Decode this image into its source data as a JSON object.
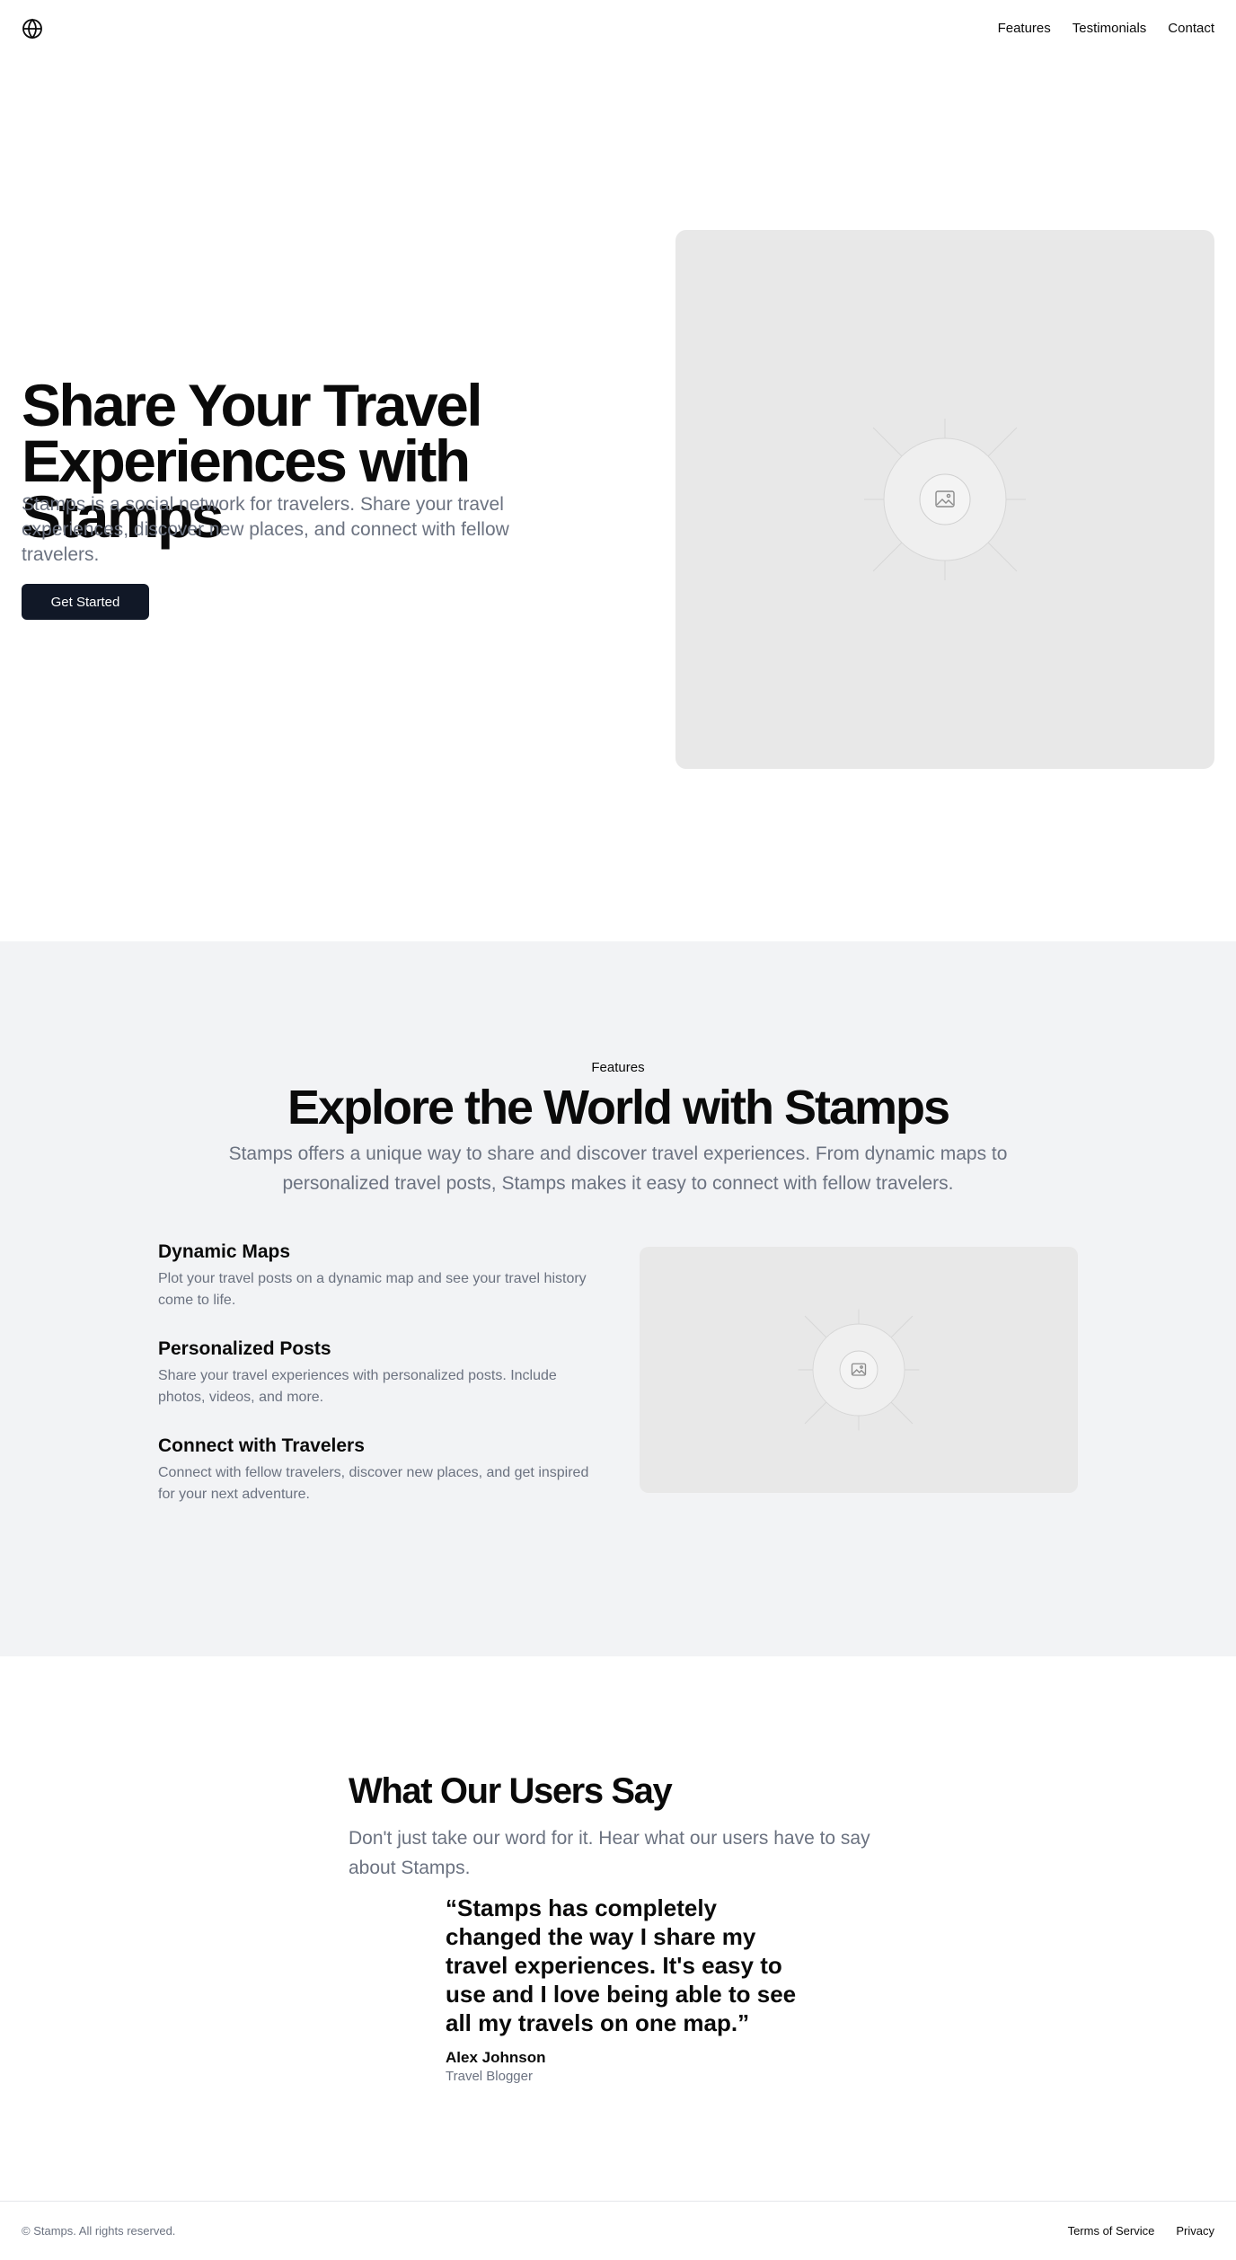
{
  "header": {
    "logo_icon": "globe-icon",
    "nav": [
      "Features",
      "Testimonials",
      "Contact"
    ]
  },
  "hero": {
    "title": "Share Your Travel Experiences with Stamps",
    "subtitle": "Stamps is a social network for travelers. Share your travel experiences, discover new places, and connect with fellow travelers.",
    "cta_label": "Get Started",
    "image_icon": "image-placeholder-icon"
  },
  "features": {
    "eyebrow": "Features",
    "title": "Explore the World with Stamps",
    "subtitle": "Stamps offers a unique way to share and discover travel experiences. From dynamic maps to personalized travel posts, Stamps makes it easy to connect with fellow travelers.",
    "items": [
      {
        "title": "Dynamic Maps",
        "text": "Plot your travel posts on a dynamic map and see your travel history come to life."
      },
      {
        "title": "Personalized Posts",
        "text": "Share your travel experiences with personalized posts. Include photos, videos, and more."
      },
      {
        "title": "Connect with Travelers",
        "text": "Connect with fellow travelers, discover new places, and get inspired for your next adventure."
      }
    ],
    "image_icon": "image-placeholder-icon"
  },
  "testimonials": {
    "title": "What Our Users Say",
    "subtitle": "Don't just take our word for it. Hear what our users have to say about Stamps.",
    "quote": "“Stamps has completely changed the way I share my travel experiences. It's easy to use and I love being able to see all my travels on one map.”",
    "author": "Alex Johnson",
    "role": "Travel Blogger"
  },
  "footer": {
    "copyright": "© Stamps. All rights reserved.",
    "links": [
      "Terms of Service",
      "Privacy"
    ]
  },
  "colors": {
    "primary_button": "#111827",
    "muted_text": "#6b7280",
    "section_bg": "#f2f3f5",
    "placeholder_bg": "#e8e8e8"
  }
}
